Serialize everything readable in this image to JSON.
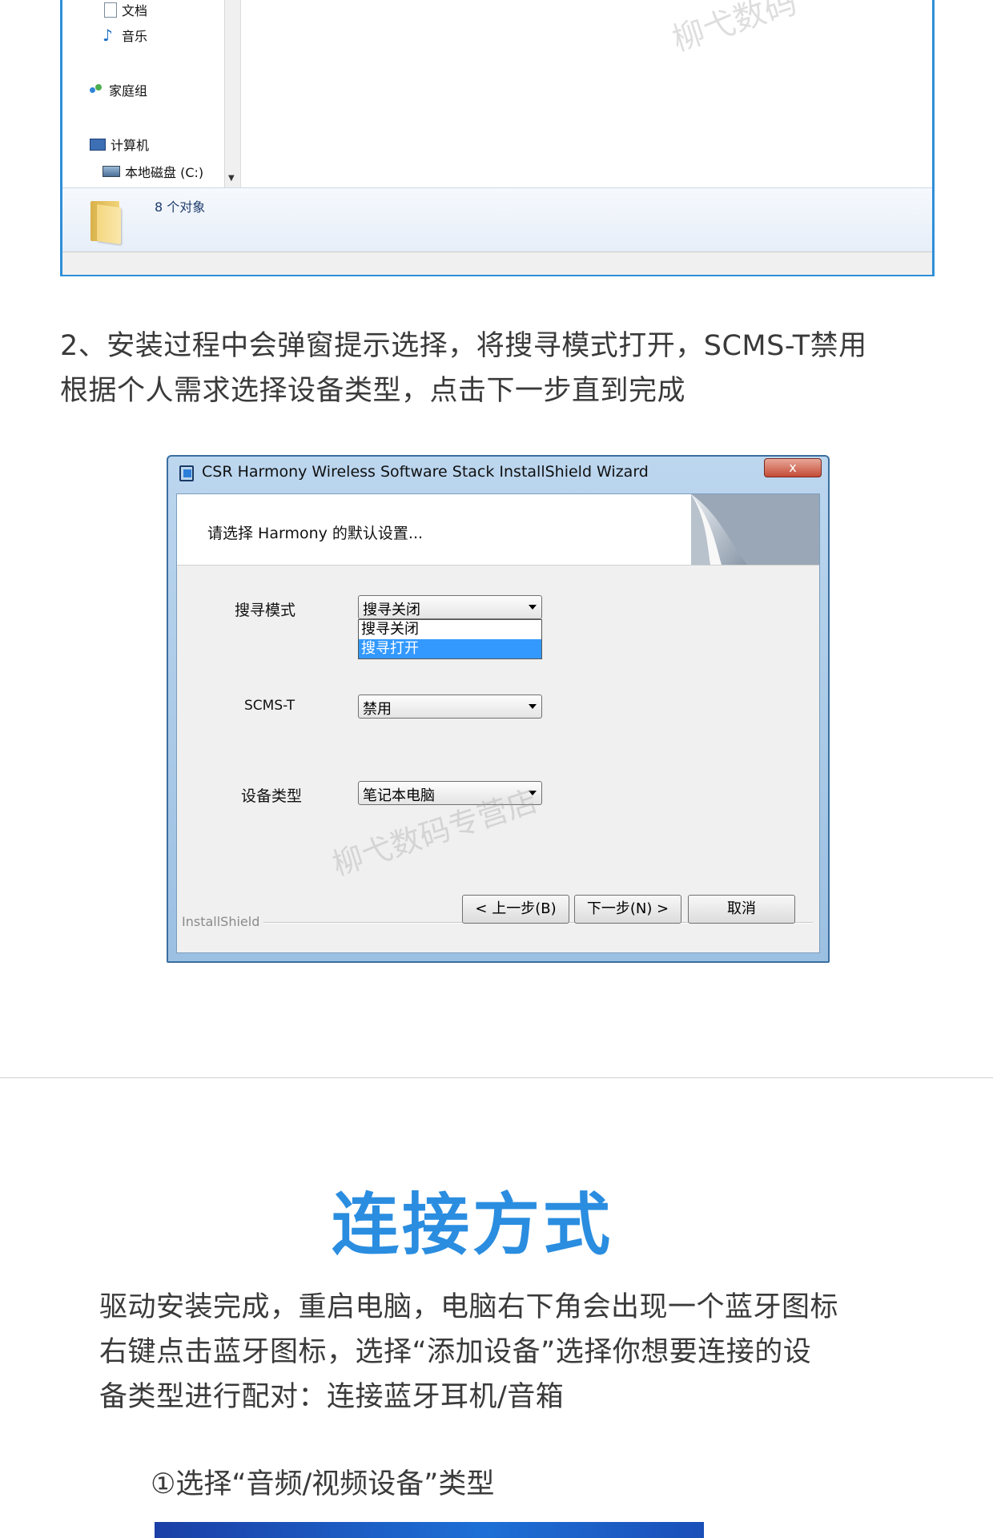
{
  "explorer": {
    "sidebar": {
      "documents_label": "文档",
      "music_label": "音乐",
      "homegroup_label": "家庭组",
      "computer_label": "计算机",
      "local_disk_label": "本地磁盘 (C:)"
    },
    "details": {
      "object_count": "8 个对象"
    },
    "watermark": "柳弋数码"
  },
  "intro": {
    "line1": "2、安装过程中会弹窗提示选择，将搜寻模式打开，SCMS-T禁用",
    "line2": "根据个人需求选择设备类型，点击下一步直到完成"
  },
  "dialog": {
    "title": "CSR Harmony Wireless Software Stack InstallShield Wizard",
    "close_label": "x",
    "header": "请选择 Harmony 的默认设置...",
    "search_mode": {
      "label": "搜寻模式",
      "value": "搜寻关闭",
      "options": [
        "搜寻关闭",
        "搜寻打开"
      ],
      "highlighted": "搜寻打开"
    },
    "scms_t": {
      "label": "SCMS-T",
      "value": "禁用"
    },
    "device_type": {
      "label": "设备类型",
      "value": "笔记本电脑"
    },
    "watermark": "柳弋数码专营店",
    "installshield_label": "InstallShield",
    "buttons": {
      "back": "< 上一步(B)",
      "next": "下一步(N) >",
      "cancel": "取消"
    }
  },
  "section": {
    "title": "连接方式",
    "para_line1": "驱动安装完成，重启电脑，电脑右下角会出现一个蓝牙图标",
    "para_line2": "右键点击蓝牙图标，选择“添加设备”选择你想要连接的设",
    "para_line3": "备类型进行配对：连接蓝牙耳机/音箱",
    "step1": "①选择“音频/视频设备”类型"
  }
}
